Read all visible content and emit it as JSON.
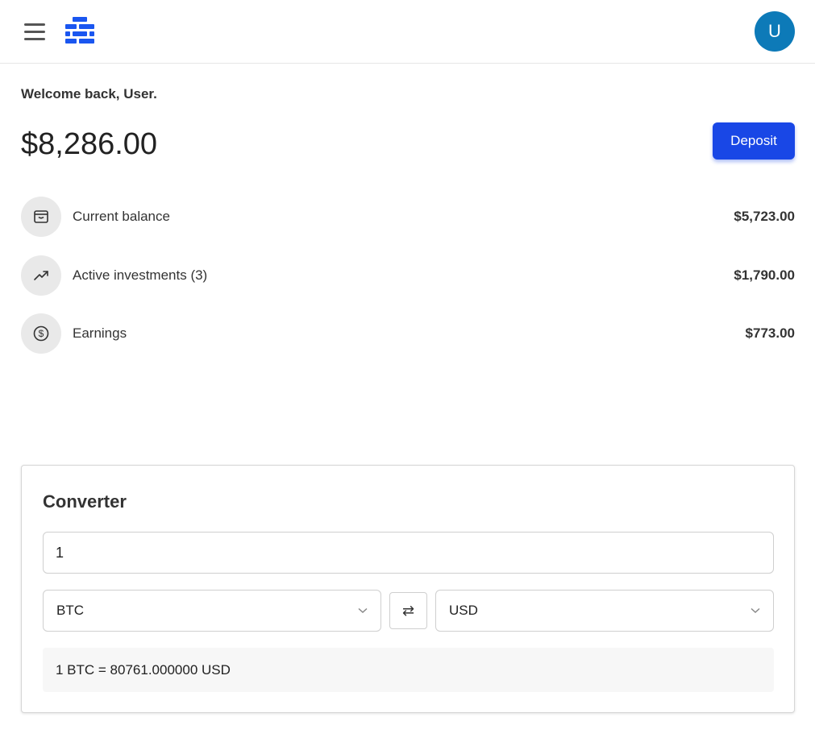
{
  "header": {
    "menu_icon": "hamburger-menu-icon",
    "logo_icon": "brick-logo-icon",
    "avatar_initial": "U"
  },
  "dashboard": {
    "welcome": "Welcome back, User.",
    "total_balance": "$8,286.00",
    "deposit_label": "Deposit",
    "stats": [
      {
        "icon": "wallet-icon",
        "label": "Current balance",
        "value": "$5,723.00"
      },
      {
        "icon": "trending-up-icon",
        "label": "Active investments (3)",
        "value": "$1,790.00"
      },
      {
        "icon": "dollar-circle-icon",
        "label": "Earnings",
        "value": "$773.00"
      }
    ]
  },
  "converter": {
    "title": "Converter",
    "amount": "1",
    "from_currency": "BTC",
    "to_currency": "USD",
    "swap_icon": "swap-arrows-icon",
    "result": "1 BTC = 80761.000000 USD"
  },
  "colors": {
    "accent": "#1947e6",
    "avatar": "#0d7ab8",
    "logo": "#1a56f0"
  }
}
